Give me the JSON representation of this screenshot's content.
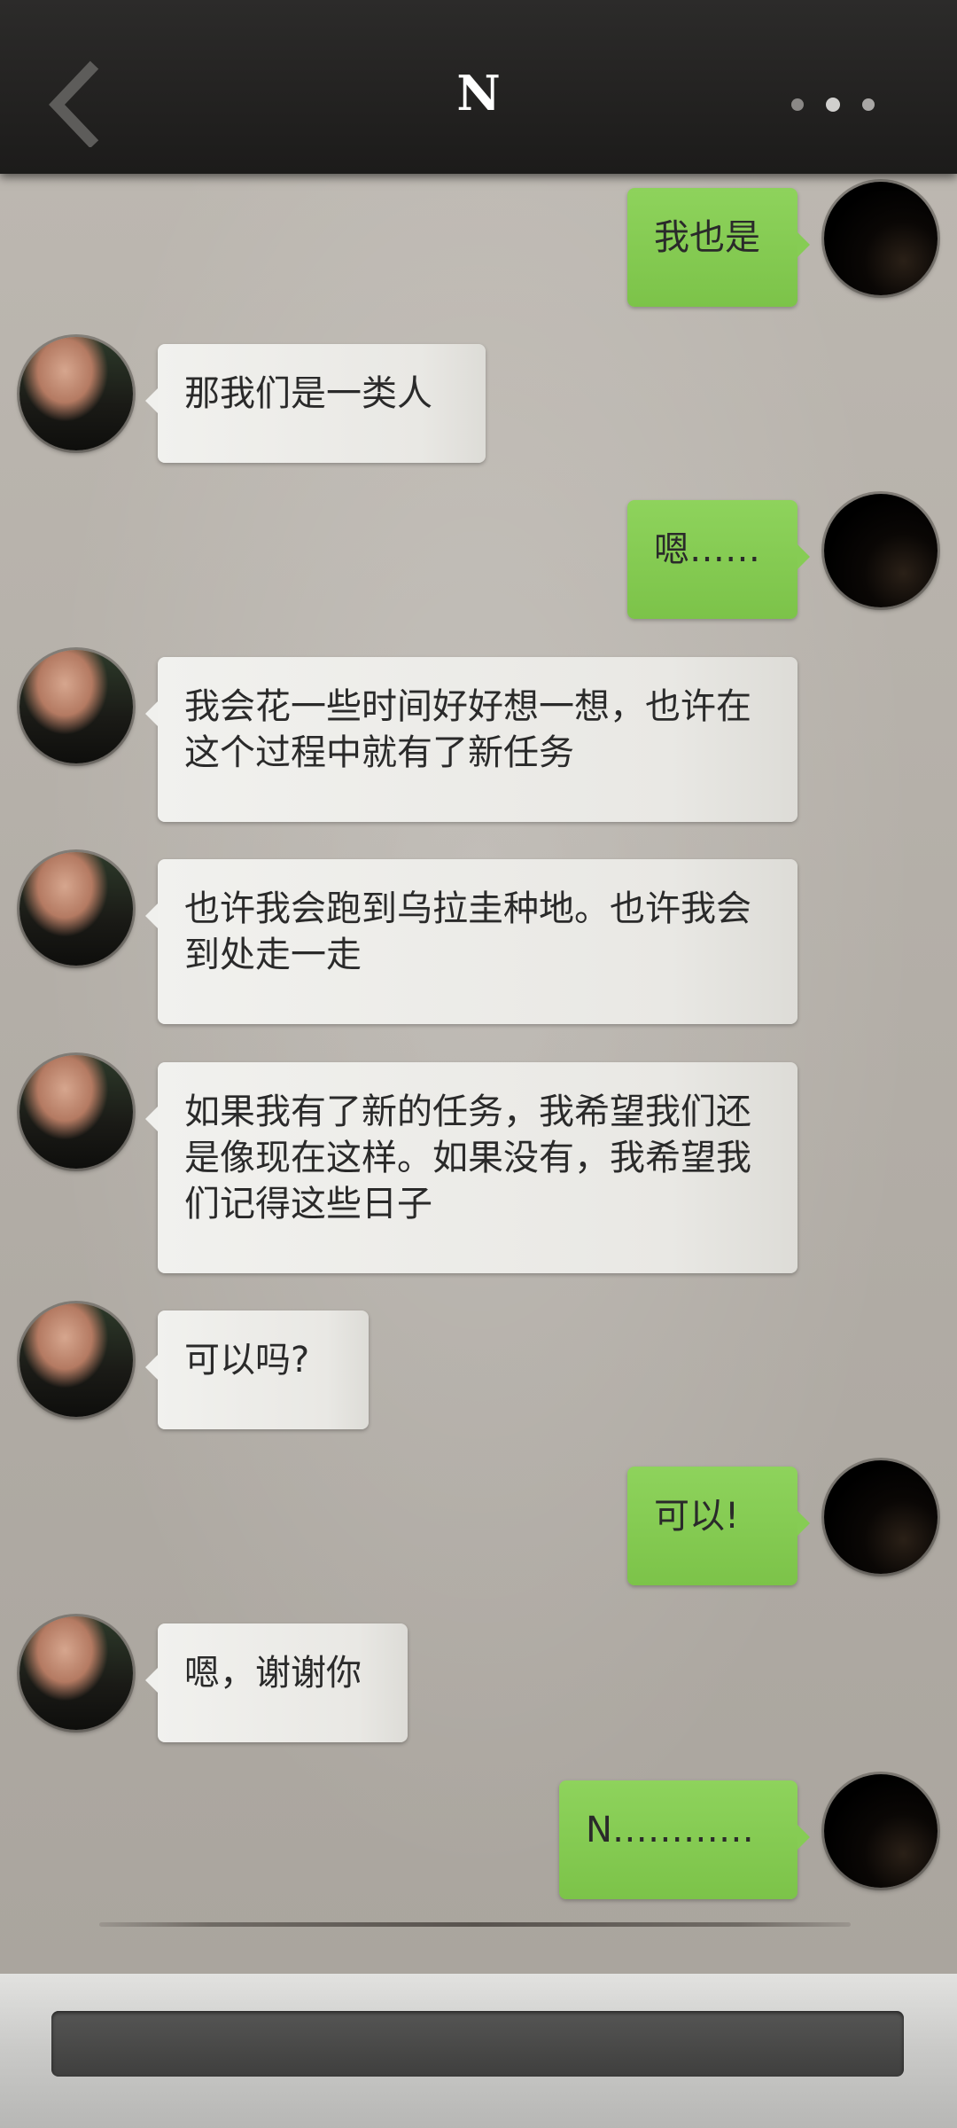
{
  "header": {
    "title": "N",
    "back_icon": "chevron-left-icon",
    "more_icon": "more-dots-icon"
  },
  "messages": [
    {
      "side": "out",
      "text": "我也是"
    },
    {
      "side": "in",
      "text": "那我们是一类人"
    },
    {
      "side": "out",
      "text": "嗯……"
    },
    {
      "side": "in",
      "text": "我会花一些时间好好想一想，也许在这个过程中就有了新任务"
    },
    {
      "side": "in",
      "text": "也许我会跑到乌拉圭种地。也许我会到处走一走"
    },
    {
      "side": "in",
      "text": "如果我有了新的任务，我希望我们还是像现在这样。如果没有，我希望我们记得这些日子"
    },
    {
      "side": "in",
      "text": "可以吗?"
    },
    {
      "side": "out",
      "text": "可以!"
    },
    {
      "side": "in",
      "text": "嗯，谢谢你"
    },
    {
      "side": "out",
      "text": "N…………"
    }
  ],
  "input": {
    "value": "",
    "placeholder": ""
  },
  "colors": {
    "header_bg": "#232221",
    "incoming_bubble": "#eeeeeb",
    "outgoing_bubble": "#86cc54",
    "chat_bg": "#b5b0a9",
    "input_bg": "#484847"
  }
}
